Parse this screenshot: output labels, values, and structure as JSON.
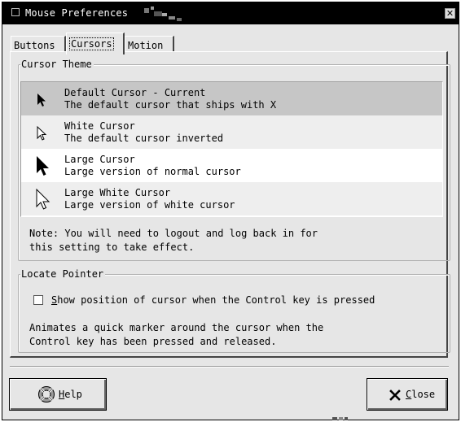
{
  "window": {
    "title": "Mouse Preferences"
  },
  "tabs": [
    {
      "label": "Buttons",
      "active": false
    },
    {
      "label": "Cursors",
      "active": true
    },
    {
      "label": "Motion",
      "active": false
    }
  ],
  "cursor_theme": {
    "heading": "Cursor Theme",
    "items": [
      {
        "icon": "arrow-cursor-icon",
        "name": "Default Cursor - Current",
        "description": "The default cursor that ships with X",
        "selected": true
      },
      {
        "icon": "white-arrow-cursor-icon",
        "name": "White Cursor",
        "description": "The default cursor inverted",
        "selected": false
      },
      {
        "icon": "large-arrow-cursor-icon",
        "name": "Large Cursor",
        "description": "Large version of normal cursor",
        "selected": false
      },
      {
        "icon": "large-white-arrow-cursor-icon",
        "name": "Large White Cursor",
        "description": "Large version of white cursor",
        "selected": false
      }
    ],
    "note": "Note: You will need to logout and log back in for\nthis setting to take effect."
  },
  "locate_pointer": {
    "heading": "Locate Pointer",
    "checkbox_mnemonic": "S",
    "checkbox_rest": "how position of cursor when the Control key is pressed",
    "checked": false,
    "description": "Animates a quick marker around the cursor when the\nControl key has been pressed and released."
  },
  "buttons": {
    "help_mnemonic": "H",
    "help_rest": "elp",
    "close_mnemonic": "C",
    "close_rest": "lose"
  },
  "icons": {
    "help": "lifebuoy-icon",
    "close": "x-icon",
    "window_close": "window-close-icon"
  }
}
